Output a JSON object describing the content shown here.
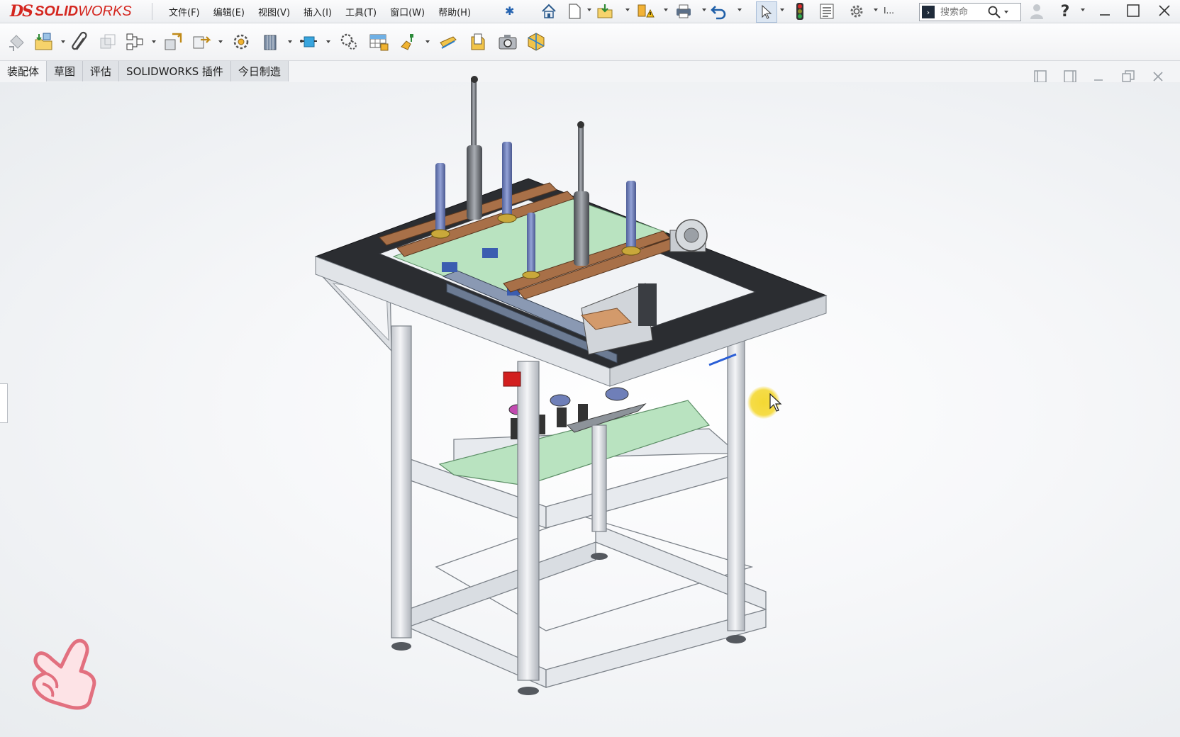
{
  "app": {
    "logo_ds": "DS",
    "logo_name_bold": "SOLID",
    "logo_name_thin": "WORKS"
  },
  "menu": [
    {
      "label": "文件(F)"
    },
    {
      "label": "编辑(E)"
    },
    {
      "label": "视图(V)"
    },
    {
      "label": "插入(I)"
    },
    {
      "label": "工具(T)"
    },
    {
      "label": "窗口(W)"
    },
    {
      "label": "帮助(H)"
    }
  ],
  "search": {
    "placeholder": "搜索命",
    "cmd_glyph": "›"
  },
  "toolbar_overflow": "I...",
  "tabs": [
    {
      "label": "装配体",
      "active": true
    },
    {
      "label": "草图",
      "active": false
    },
    {
      "label": "评估",
      "active": false
    },
    {
      "label": "SOLIDWORKS 插件",
      "active": false
    },
    {
      "label": "今日制造",
      "active": false
    }
  ],
  "colors": {
    "brand": "#d4261f",
    "frame_aluminum": "#d7dade",
    "tabletop": "#2b2d31",
    "cylinder": "#6f7fb8",
    "plate": "#b9e3c0",
    "rail": "#a87048",
    "highlight": "#f4d628"
  }
}
